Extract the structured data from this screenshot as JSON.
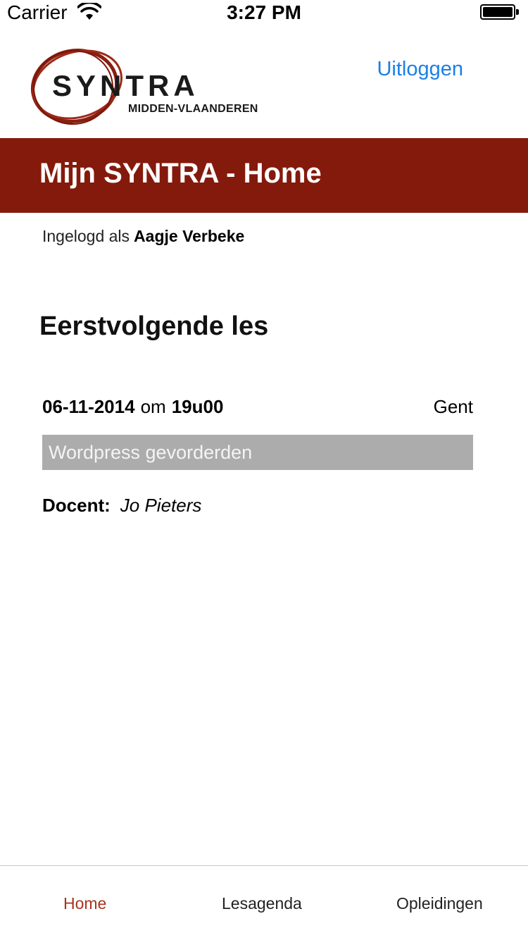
{
  "status_bar": {
    "carrier": "Carrier",
    "time": "3:27 PM"
  },
  "header": {
    "logo_word": "SYNTRA",
    "logo_sub": "MIDDEN-VLAANDEREN",
    "logout_label": "Uitloggen"
  },
  "title_bar": {
    "title": "Mijn SYNTRA - Home"
  },
  "user": {
    "logged_in_label": "Ingelogd als",
    "name": "Aagje Verbeke"
  },
  "next_lesson": {
    "heading": "Eerstvolgende les",
    "date": "06-11-2014",
    "connector": "om",
    "time": "19u00",
    "location": "Gent",
    "course": "Wordpress gevorderden",
    "teacher_label": "Docent:",
    "teacher_name": "Jo Pieters"
  },
  "tabs": [
    {
      "label": "Home",
      "active": true
    },
    {
      "label": "Lesagenda",
      "active": false
    },
    {
      "label": "Opleidingen",
      "active": false
    }
  ],
  "colors": {
    "brand_red": "#841a0c",
    "link_blue": "#1a7fe6",
    "active_tab": "#a8341e",
    "course_bar": "#acacac"
  }
}
